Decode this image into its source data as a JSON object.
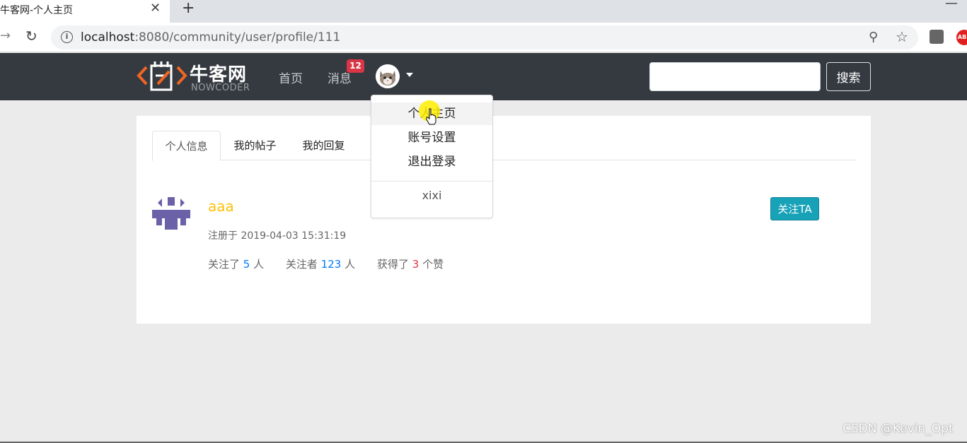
{
  "browser": {
    "tab_title": "牛客网-个人主页",
    "tab_close": "✕",
    "new_tab": "+",
    "minimize": "—",
    "url_host": "localhost",
    "url_path": ":8080/community/user/profile/111"
  },
  "navbar": {
    "logo_cn": "牛客网",
    "logo_en": "NOWCODER",
    "home": "首页",
    "messages": "消息",
    "message_count": "12",
    "search_placeholder": "",
    "search_button": "搜索"
  },
  "dropdown": {
    "items": [
      "个人主页",
      "账号设置",
      "退出登录"
    ],
    "username": "xixi"
  },
  "profile": {
    "tabs": [
      "个人信息",
      "我的帖子",
      "我的回复"
    ],
    "active_tab": 0,
    "username": "aaa",
    "register_label": "注册于 2019-04-03 15:31:19",
    "following_prefix": "关注了",
    "following_count": "5",
    "following_suffix": "人",
    "followers_prefix": "关注者",
    "followers_count": "123",
    "followers_suffix": "人",
    "likes_prefix": "获得了",
    "likes_count": "3",
    "likes_suffix": "个赞",
    "follow_button": "关注TA"
  },
  "watermark": "CSDN @Kevin_Opt",
  "colors": {
    "navbar_bg": "#343a40",
    "page_bg": "#ebebeb",
    "username": "#ffc107",
    "count_blue": "#007bff",
    "count_red": "#dc3545",
    "badge": "#dc3545",
    "follow_button": "#17a2b8",
    "logo_orange": "#f26522"
  }
}
